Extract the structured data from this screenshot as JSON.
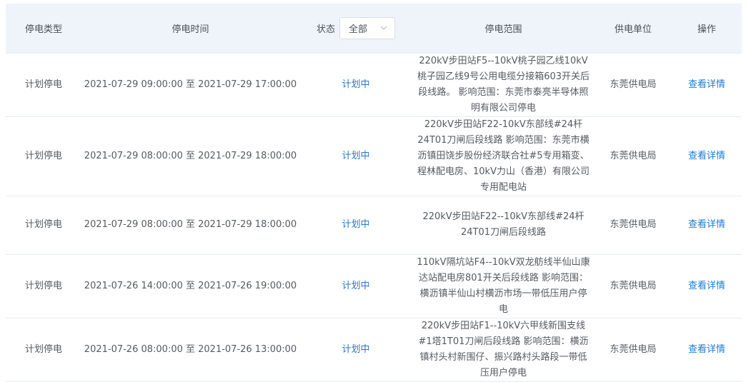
{
  "header": {
    "type": "停电类型",
    "time": "停电时间",
    "status_label": "状态",
    "status_select": "全部",
    "range": "停电范围",
    "unit": "供电单位",
    "action": "操作"
  },
  "rows": [
    {
      "type": "计划停电",
      "time": "2021-07-29 09:00:00 至 2021-07-29 17:00:00",
      "status": "计划中",
      "range": "220kV步田站F5--10kV桃子园乙线10kV桃子园乙线9号公用电缆分接箱603开关后段线路。 影响范围：东莞市泰亮半导体照明有限公司停电",
      "unit": "东莞供电局",
      "action": "查看详情"
    },
    {
      "type": "计划停电",
      "time": "2021-07-29 08:00:00 至 2021-07-29 18:00:00",
      "status": "计划中",
      "range": "220kV步田站F22-10kV东部线#24杆24T01刀闸后段线路 影响范围：东莞市横沥镇田饶步股份经济联合社#5专用箱变、程林配电房、10kV力山（香港）有限公司专用配电站",
      "unit": "东莞供电局",
      "action": "查看详情"
    },
    {
      "type": "计划停电",
      "time": "2021-07-29 08:00:00 至 2021-07-29 18:00:00",
      "status": "计划中",
      "range": "220kV步田站F22--10kV东部线#24杆24T01刀闸后段线路",
      "unit": "东莞供电局",
      "action": "查看详情"
    },
    {
      "type": "计划停电",
      "time": "2021-07-26 14:00:00 至 2021-07-26 19:00:00",
      "status": "计划中",
      "range": "110kV隔坑站F4--10kV双龙舫线半仙山康达站配电房801开关后段线路 影响范围：横沥镇半仙山村横沥市场一带低压用户停电",
      "unit": "东莞供电局",
      "action": "查看详情"
    },
    {
      "type": "计划停电",
      "time": "2021-07-26 08:00:00 至 2021-07-26 13:00:00",
      "status": "计划中",
      "range": "220kV步田站F1--10kV六甲线新围支线#1塔1T01刀闸后段线路 影响范围：横沥镇村头村新围仔、振兴路村头路段一带低压用户停电",
      "unit": "东莞供电局",
      "action": "查看详情"
    }
  ]
}
